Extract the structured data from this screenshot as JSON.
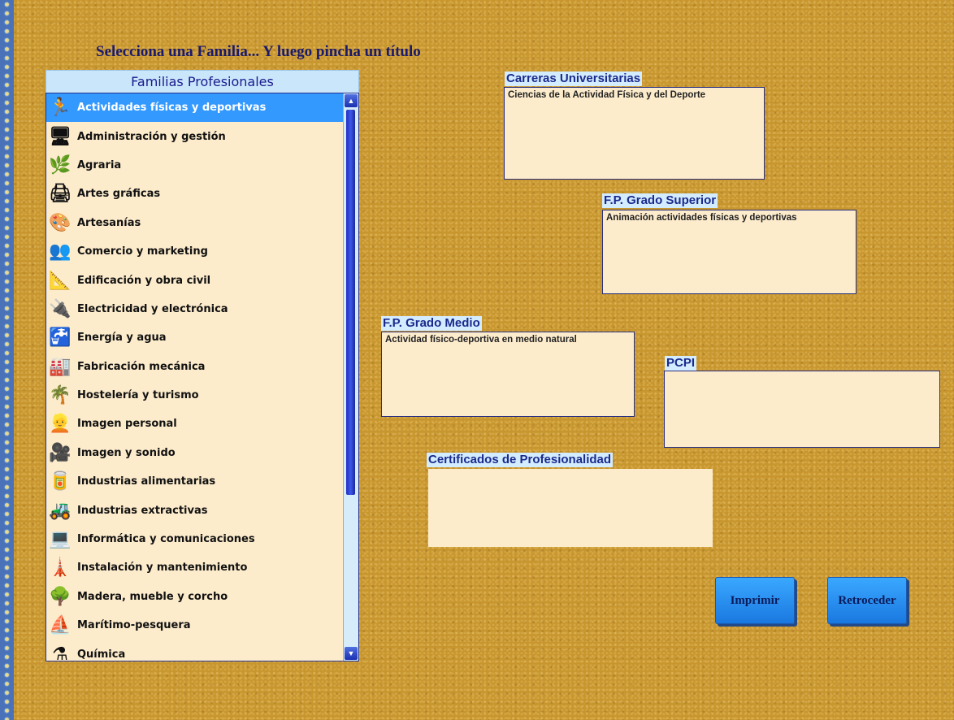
{
  "instruction": "Selecciona una Familia... Y luego pincha un título",
  "families_header": "Familias Profesionales",
  "families": [
    {
      "label": "Actividades físicas y deportivas",
      "icon": "runner-icon",
      "glyph": "🏃",
      "selected": true
    },
    {
      "label": "Administración y gestión",
      "icon": "computer-office-icon",
      "glyph": "🖥"
    },
    {
      "label": "Agraria",
      "icon": "plants-icon",
      "glyph": "🌿"
    },
    {
      "label": "Artes gráficas",
      "icon": "printing-icon",
      "glyph": "🖨"
    },
    {
      "label": "Artesanías",
      "icon": "palette-icon",
      "glyph": "🎨"
    },
    {
      "label": "Comercio y marketing",
      "icon": "business-people-icon",
      "glyph": "👥"
    },
    {
      "label": "Edificación y obra civil",
      "icon": "construction-tools-icon",
      "glyph": "📐"
    },
    {
      "label": "Electricidad y electrónica",
      "icon": "electric-plug-icon",
      "glyph": "🔌"
    },
    {
      "label": "Energía y agua",
      "icon": "water-tap-icon",
      "glyph": "🚰"
    },
    {
      "label": "Fabricación mecánica",
      "icon": "factory-icon",
      "glyph": "🏭"
    },
    {
      "label": "Hostelería y turismo",
      "icon": "palm-tree-icon",
      "glyph": "🌴"
    },
    {
      "label": "Imagen personal",
      "icon": "blonde-woman-icon",
      "glyph": "👱"
    },
    {
      "label": "Imagen y sonido",
      "icon": "video-camera-icon",
      "glyph": "🎥"
    },
    {
      "label": "Industrias alimentarias",
      "icon": "food-cans-icon",
      "glyph": "🥫"
    },
    {
      "label": "Industrias extractivas",
      "icon": "excavator-icon",
      "glyph": "🚜"
    },
    {
      "label": "Informática y comunicaciones",
      "icon": "computer-icon",
      "glyph": "💻"
    },
    {
      "label": "Instalación y mantenimiento",
      "icon": "utility-pole-icon",
      "glyph": "🗼"
    },
    {
      "label": "Madera, mueble y corcho",
      "icon": "tree-icon",
      "glyph": "🌳"
    },
    {
      "label": "Marítimo-pesquera",
      "icon": "ship-icon",
      "glyph": "⛵"
    },
    {
      "label": "Química",
      "icon": "chemistry-flask-icon",
      "glyph": "⚗"
    }
  ],
  "carreras": {
    "label": "Carreras Universitarias",
    "content": "Ciencias de la Actividad Física y del Deporte"
  },
  "fp_superior": {
    "label": "F.P. Grado Superior",
    "content": "Animación actividades físicas y deportivas"
  },
  "fp_medio": {
    "label": "F.P. Grado Medio",
    "content": "Actividad físico-deportiva en medio natural"
  },
  "pcpi": {
    "label": "PCPI",
    "content": ""
  },
  "certificados": {
    "label": "Certificados de Profesionalidad",
    "content": ""
  },
  "buttons": {
    "print": "Imprimir",
    "back": "Retroceder"
  },
  "colors": {
    "background": "#c8962e",
    "selected": "#3399ff",
    "box_fill": "#fdeccc",
    "label_text": "#1a2a8c"
  }
}
